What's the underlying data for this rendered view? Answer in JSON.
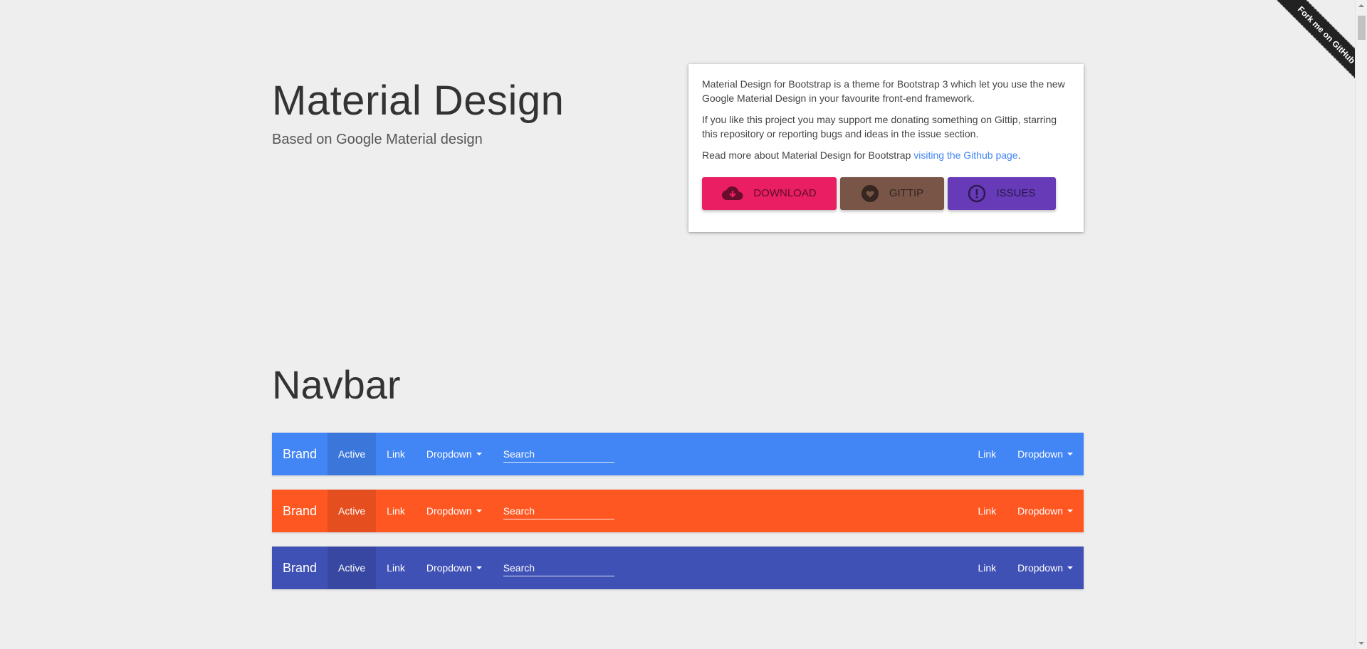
{
  "header": {
    "title": "Material Design",
    "subtitle": "Based on Google Material design"
  },
  "card": {
    "paragraph1": "Material Design for Bootstrap is a theme for Bootstrap 3 which let you use the new Google Material Design in your favourite front-end framework.",
    "paragraph2": "If you like this project you may support me donating something on Gittip, starring this repository or reporting bugs and ideas in the issue section.",
    "paragraph3_prefix": "Read more about Material Design for Bootstrap ",
    "paragraph3_link": "visiting the Github page",
    "paragraph3_suffix": ".",
    "buttons": [
      {
        "label": "Download",
        "icon": "cloud-download-icon",
        "color": "#e91e63"
      },
      {
        "label": "Gittip",
        "icon": "heart-icon",
        "color": "#795548"
      },
      {
        "label": "Issues",
        "icon": "alert-circle-icon",
        "color": "#673ab7"
      }
    ]
  },
  "section": {
    "title": "Navbar"
  },
  "navbars": [
    {
      "color": "#4285f4",
      "brand": "Brand",
      "left_items": [
        "Active",
        "Link",
        "Dropdown"
      ],
      "search_placeholder": "Search",
      "right_items": [
        "Link",
        "Dropdown"
      ]
    },
    {
      "color": "#ff5722",
      "brand": "Brand",
      "left_items": [
        "Active",
        "Link",
        "Dropdown"
      ],
      "search_placeholder": "Search",
      "right_items": [
        "Link",
        "Dropdown"
      ]
    },
    {
      "color": "#3f51b5",
      "brand": "Brand",
      "left_items": [
        "Active",
        "Link",
        "Dropdown"
      ],
      "search_placeholder": "Search",
      "right_items": [
        "Link",
        "Dropdown"
      ]
    }
  ],
  "ribbon": {
    "label": "Fork me on GitHub"
  }
}
